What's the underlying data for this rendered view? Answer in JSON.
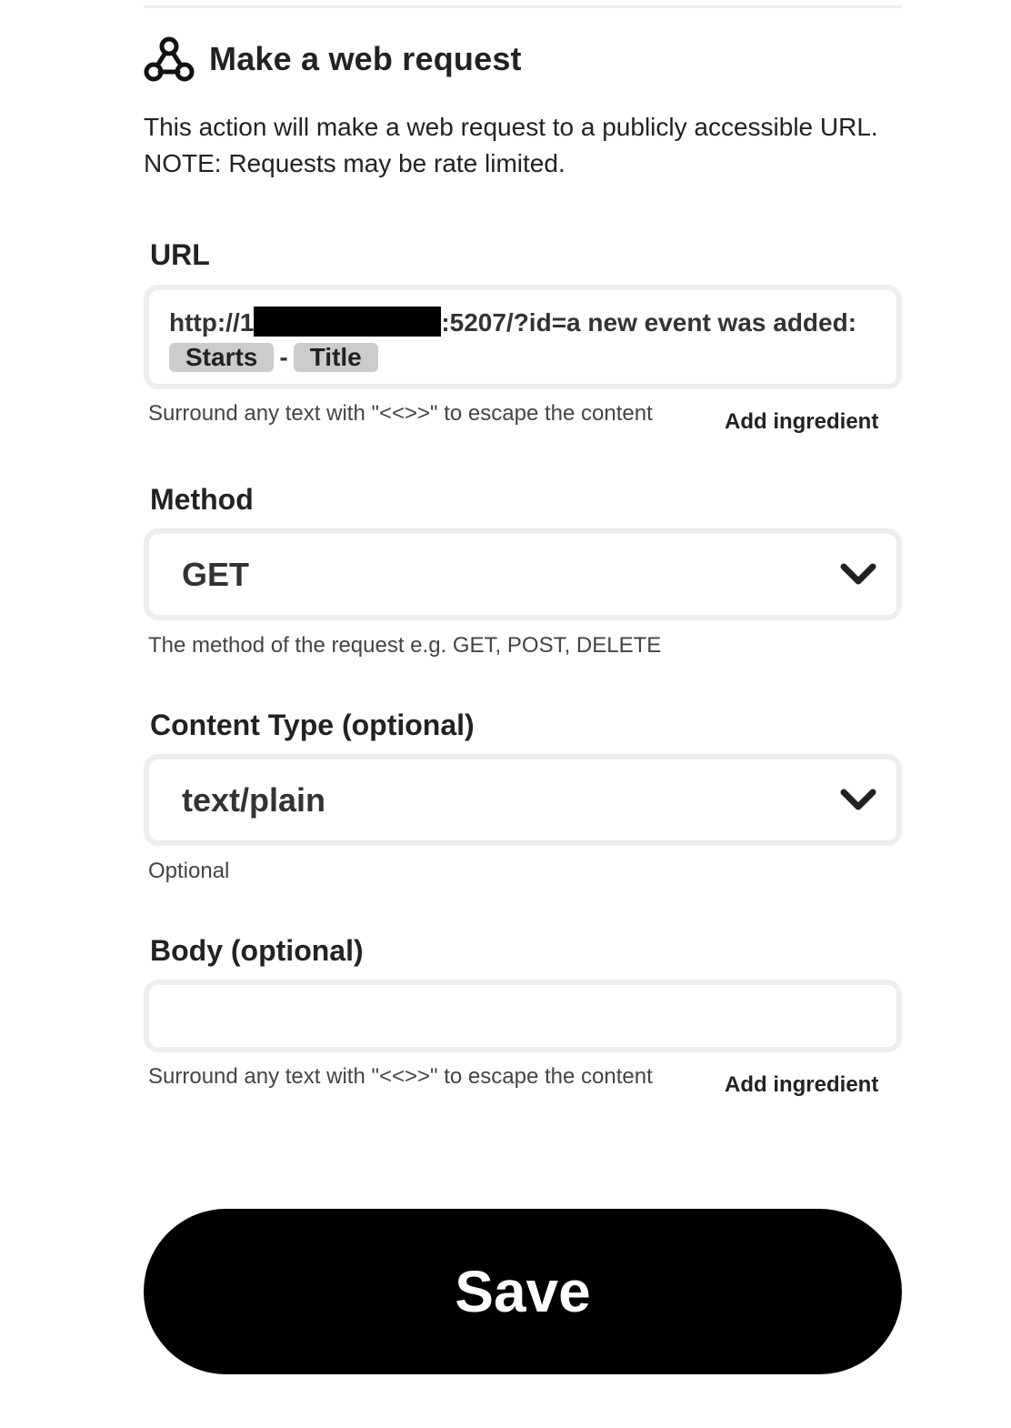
{
  "header": {
    "title": "Make a web request",
    "icon": "webhook-icon"
  },
  "description": {
    "line1": "This action will make a web request to a publicly accessible URL.",
    "line2": "NOTE: Requests may be rate limited."
  },
  "url_field": {
    "label": "URL",
    "value_prefix": "http://1",
    "value_suffix": ":5207/?id=a new event was added:",
    "ingredients": [
      "Starts",
      "Title"
    ],
    "ingredient_separator": "-",
    "helper": "Surround any text with \"<<>>\" to escape the content",
    "add_ingredient": "Add ingredient"
  },
  "method_field": {
    "label": "Method",
    "value": "GET",
    "helper": "The method of the request e.g. GET, POST, DELETE"
  },
  "content_type_field": {
    "label": "Content Type (optional)",
    "value": "text/plain",
    "helper": "Optional"
  },
  "body_field": {
    "label": "Body (optional)",
    "value": "",
    "helper": "Surround any text with \"<<>>\" to escape the content",
    "add_ingredient": "Add ingredient"
  },
  "save_button": {
    "label": "Save"
  },
  "colors": {
    "field_border": "#eeeeee",
    "pill_background": "#cccccc",
    "button_background": "#000000",
    "button_text": "#ffffff"
  }
}
